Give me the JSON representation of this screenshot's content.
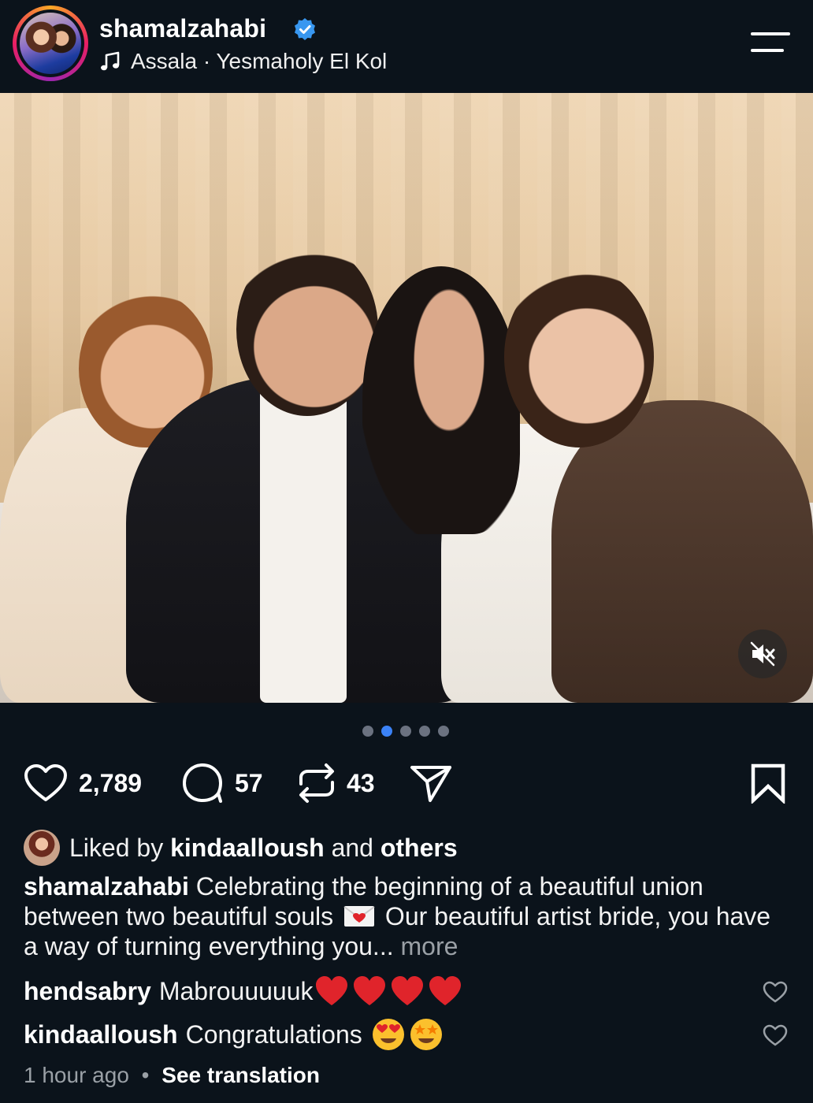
{
  "header": {
    "username": "shamalzahabi",
    "music": "Assala · Yesmaholy El Kol",
    "icons": [
      "verified-badge-icon",
      "music-note-icon",
      "menu-icon"
    ]
  },
  "post": {
    "media_description_icons": [
      "mute-icon"
    ],
    "carousel": {
      "total": 5,
      "active_index": 1
    }
  },
  "actions": {
    "likes": "2,789",
    "comments": "57",
    "reposts": "43"
  },
  "liked_by": {
    "prefix": "Liked by",
    "user": "kindaalloush",
    "connector": "and",
    "others": "others"
  },
  "caption": {
    "author": "shamalzahabi",
    "text_before_emoji": "Celebrating the beginning of a beautiful union between two beautiful souls",
    "text_after_emoji": "Our beautiful artist bride, you have a way of turning everything you...",
    "more_label": "more"
  },
  "comments": [
    {
      "author": "hendsabry",
      "text": "Mabrouuuuuk"
    },
    {
      "author": "kindaalloush",
      "text": "Congratulations"
    }
  ],
  "meta": {
    "time": "1 hour ago",
    "separator": "•",
    "translate": "See translation"
  },
  "colors": {
    "background": "#0b131b",
    "verified": "#3897f0",
    "active_dot": "#3b82f6",
    "heart_emoji": "#e0242b"
  }
}
